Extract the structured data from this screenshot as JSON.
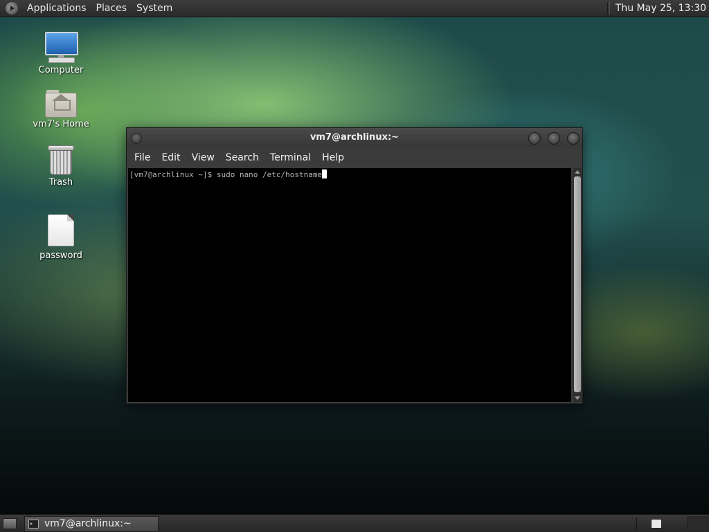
{
  "top_panel": {
    "menus": [
      "Applications",
      "Places",
      "System"
    ],
    "clock": "Thu May 25, 13:30"
  },
  "desktop": {
    "icons": [
      {
        "label": "Computer",
        "icon": "computer-icon"
      },
      {
        "label": "vm7's Home",
        "icon": "home-folder-icon"
      },
      {
        "label": "Trash",
        "icon": "trash-icon"
      },
      {
        "label": "password",
        "icon": "text-file-icon"
      }
    ]
  },
  "terminal": {
    "title": "vm7@archlinux:~",
    "menus": [
      "File",
      "Edit",
      "View",
      "Search",
      "Terminal",
      "Help"
    ],
    "line": "[vm7@archlinux ~]$ sudo nano /etc/hostname"
  },
  "bottom_panel": {
    "task_label": "vm7@archlinux:~"
  }
}
